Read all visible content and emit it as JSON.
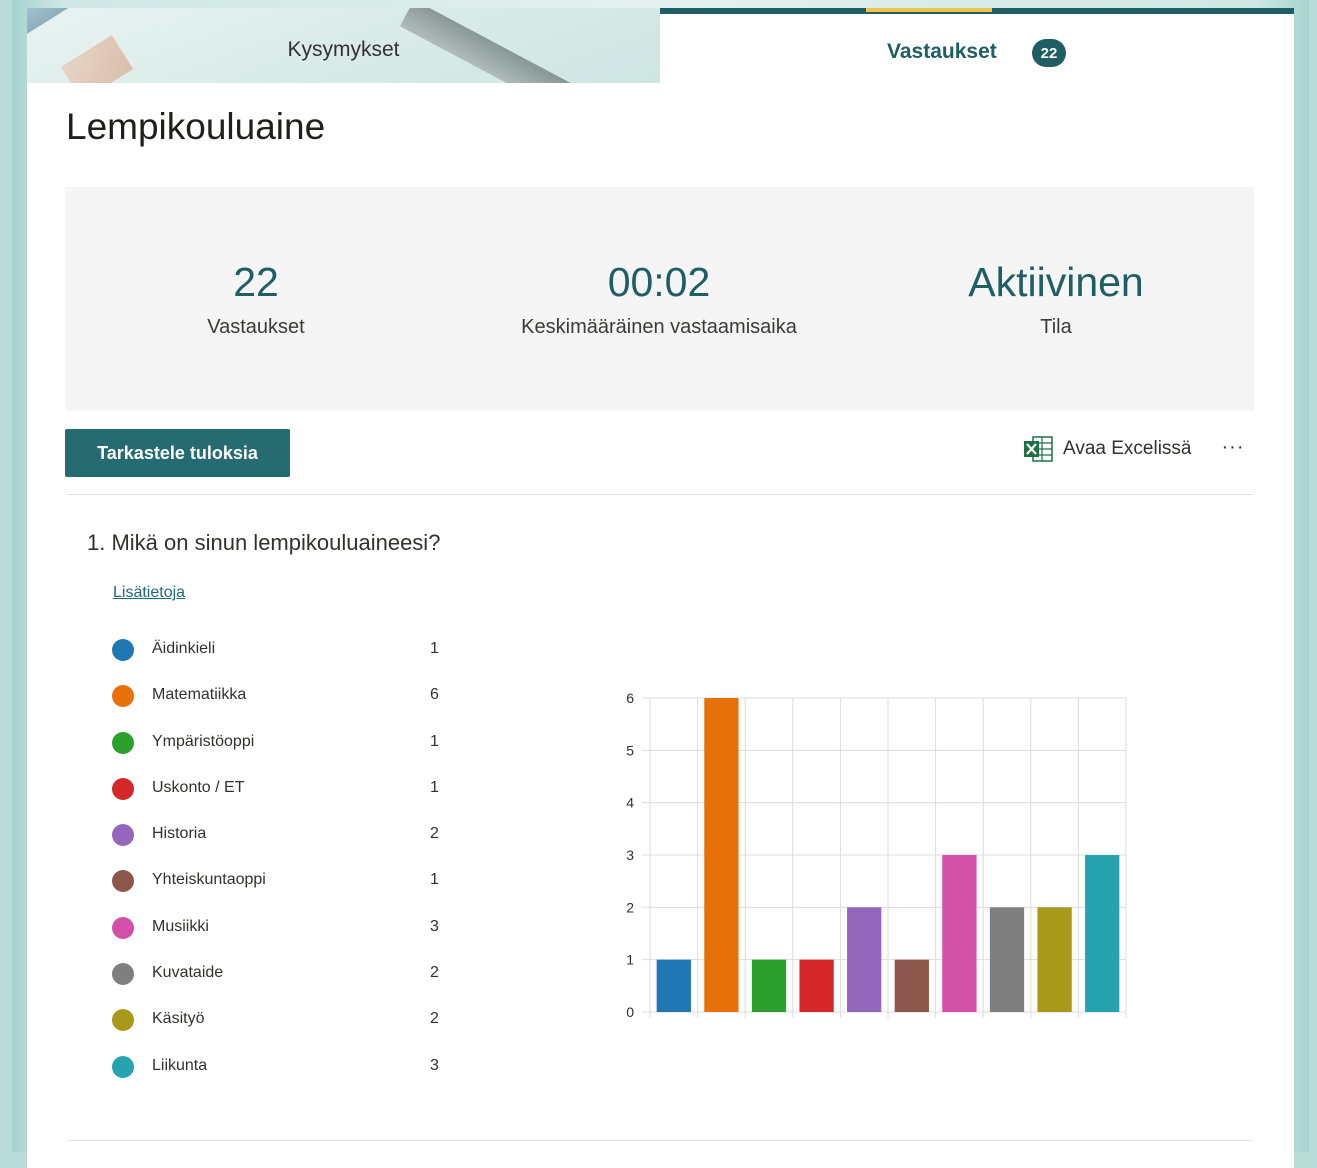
{
  "tabs": {
    "questions_label": "Kysymykset",
    "responses_label": "Vastaukset",
    "responses_count": "22"
  },
  "form_title": "Lempikouluaine",
  "summary": {
    "responses_value": "22",
    "responses_label": "Vastaukset",
    "avg_time_value": "00:02",
    "avg_time_label": "Keskimääräinen vastaamisaika",
    "status_value": "Aktiivinen",
    "status_label": "Tila"
  },
  "actions": {
    "view_results": "Tarkastele tuloksia",
    "open_excel": "Avaa Excelissä",
    "excel_icon": "excel-icon",
    "more_icon": "more-options-icon",
    "more_text": "···"
  },
  "question": {
    "text": "1. Mikä on sinun lempikouluaineesi?",
    "more_info": "Lisätietoja"
  },
  "colors": {
    "accent": "#1f5e63",
    "button": "#256b70"
  },
  "chart_data": {
    "type": "bar",
    "categories": [
      "Äidinkieli",
      "Matematiikka",
      "Ympäristöoppi",
      "Uskonto / ET",
      "Historia",
      "Yhteiskuntaoppi",
      "Musiikki",
      "Kuvataide",
      "Käsityö",
      "Liikunta"
    ],
    "values": [
      1,
      6,
      1,
      1,
      2,
      1,
      3,
      2,
      2,
      3
    ],
    "colors": [
      "#1f77b4",
      "#e8700a",
      "#2ca02c",
      "#d62728",
      "#9467bd",
      "#8c564b",
      "#d44fa9",
      "#7f7f7f",
      "#a8991a",
      "#26a3ae"
    ],
    "ylim": [
      0,
      6
    ],
    "yticks": [
      0,
      1,
      2,
      3,
      4,
      5,
      6
    ],
    "grid": true,
    "title": "",
    "xlabel": "",
    "ylabel": ""
  }
}
